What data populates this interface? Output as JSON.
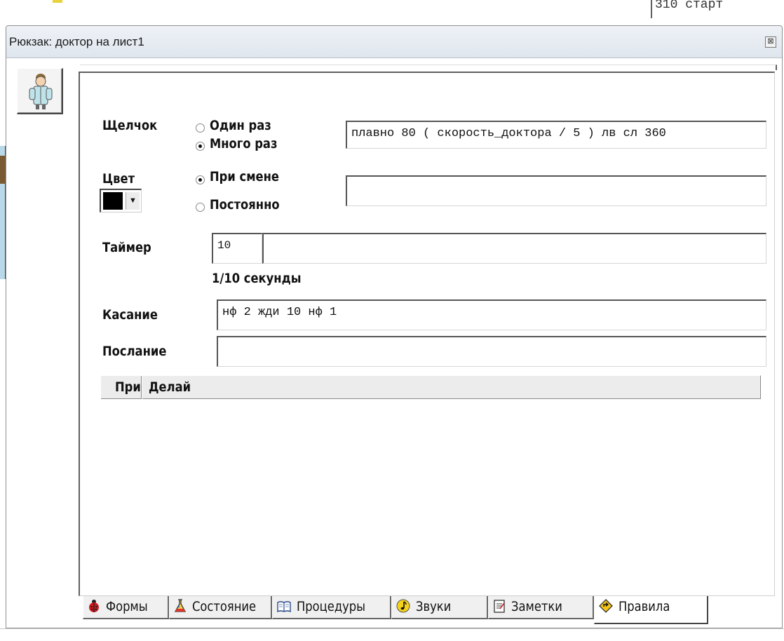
{
  "background": {
    "top_right_text": "310 старт"
  },
  "dialog": {
    "title": "Рюкзак: доктор на лист1",
    "close_glyph": "⊠",
    "sprite_icon": "doctor-sprite-icon"
  },
  "form": {
    "click_label": "Щелчок",
    "click_options": [
      "Один раз",
      "Много раз"
    ],
    "click_selected": "Много раз",
    "click_command": "плавно 80 ( скорость_доктора / 5 ) лв сл 360",
    "color_label": "Цвет",
    "color_value": "#000000",
    "color_options": [
      "При смене",
      "Постоянно"
    ],
    "color_selected": "При смене",
    "color_command": "",
    "timer_label": "Таймер",
    "timer_value": "10",
    "timer_unit": "1/10 секунды",
    "timer_command": "",
    "touch_label": "Касание",
    "touch_command": "нф 2 жди 10 нф 1",
    "message_label": "Послание",
    "message_command": ""
  },
  "rules_table": {
    "columns": [
      "При",
      "Делай"
    ],
    "rows": []
  },
  "tabs": [
    {
      "label": "Формы",
      "icon": "ladybug-icon"
    },
    {
      "label": "Состояние",
      "icon": "flask-icon"
    },
    {
      "label": "Процедуры",
      "icon": "book-icon"
    },
    {
      "label": "Звуки",
      "icon": "music-note-icon"
    },
    {
      "label": "Заметки",
      "icon": "notepad-icon"
    },
    {
      "label": "Правила",
      "icon": "diamond-arrow-icon",
      "active": true
    }
  ]
}
